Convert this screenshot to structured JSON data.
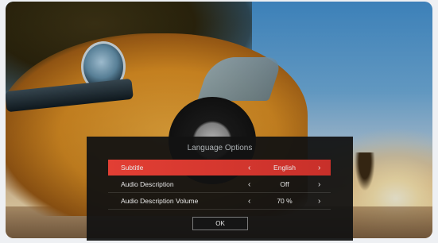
{
  "dialog": {
    "title": "Language Options",
    "rows": [
      {
        "label": "Subtitle",
        "value": "English",
        "active": true
      },
      {
        "label": "Audio Description",
        "value": "Off",
        "active": false
      },
      {
        "label": "Audio Description Volume",
        "value": "70 %",
        "active": false
      }
    ],
    "prev_glyph": "‹",
    "next_glyph": "›",
    "ok_label": "OK"
  },
  "colors": {
    "active_row": "#e23f34",
    "dialog_bg": "#121212"
  },
  "icons": [
    "chevron-left-icon",
    "chevron-right-icon"
  ]
}
